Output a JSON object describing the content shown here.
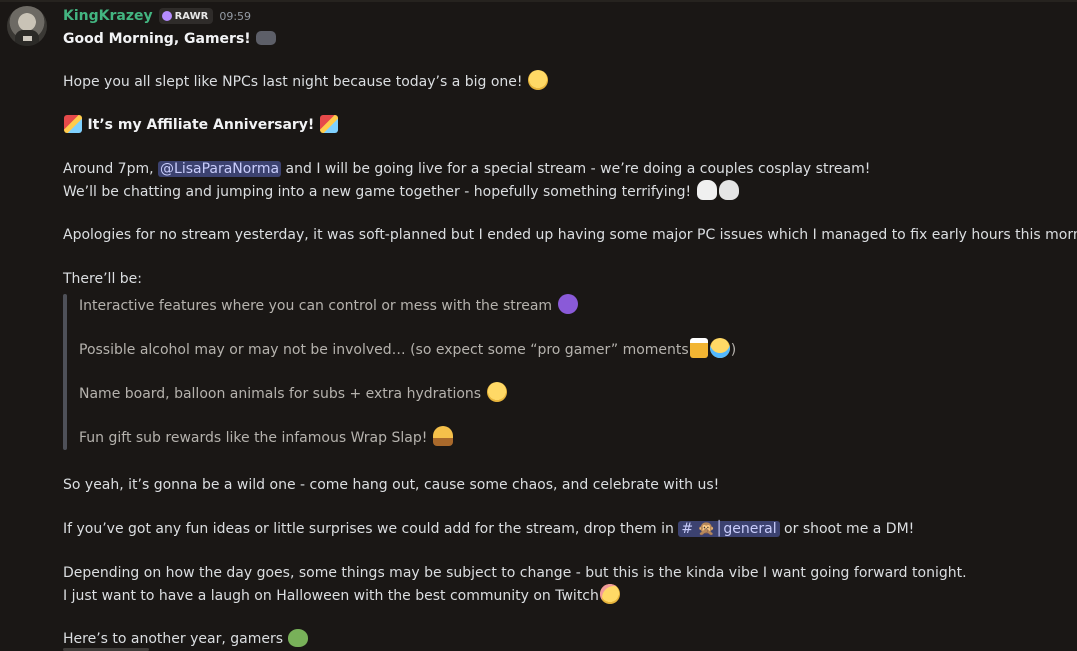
{
  "message": {
    "author": "KingKrazey",
    "role_tag": "RAWR",
    "timestamp": "09:59",
    "title": "Good Morning, Gamers!",
    "line_intro": "Hope you all slept like NPCs last night because today’s a big one!",
    "anniversary": "It’s my Affiliate Anniversary!",
    "stream_pre": "Around 7pm,",
    "mention": "@LisaParaNorma",
    "stream_post": "and I will be going live  for a special stream - we’re doing a couples cosplay stream!",
    "chatting": "We’ll be chatting and jumping into a new game together - hopefully something terrifying!",
    "apology": "Apologies for no stream yesterday, it was soft-planned but I ended up having some major PC issues which I managed to fix early hours this morning",
    "there_be": "There’ll be:",
    "quote_items": [
      "Interactive features where you can control or mess with the stream",
      "Possible alcohol may or may not be involved… (so expect some “pro gamer” moments",
      "Name board, balloon animals for subs + extra hydrations",
      "Fun gift sub rewards like the infamous Wrap Slap!"
    ],
    "quote_item2_close": ")",
    "so_yeah": "So yeah, it’s gonna be a wild one - come hang out, cause some chaos, and celebrate with us!",
    "ideas_pre": "If you’ve got any fun ideas or little surprises we could add for the stream, drop them in",
    "channel": "# 🙊│general",
    "ideas_post": "or shoot me a DM!",
    "depending": "Depending on how the day goes, some things may be subject to change - but this is the kinda vibe I want going forward tonight.",
    "laugh": "I just want to have a laugh on Halloween with the best community on Twitch",
    "closing": "Here’s to another year, gamers"
  },
  "icons": {
    "role": "role-badge-icon",
    "emoji": [
      "game-controller",
      "smirk",
      "party-popper",
      "ghost",
      "skull",
      "smiling-imp",
      "beer-mugs",
      "joy",
      "taco",
      "blush",
      "green-heart"
    ]
  }
}
